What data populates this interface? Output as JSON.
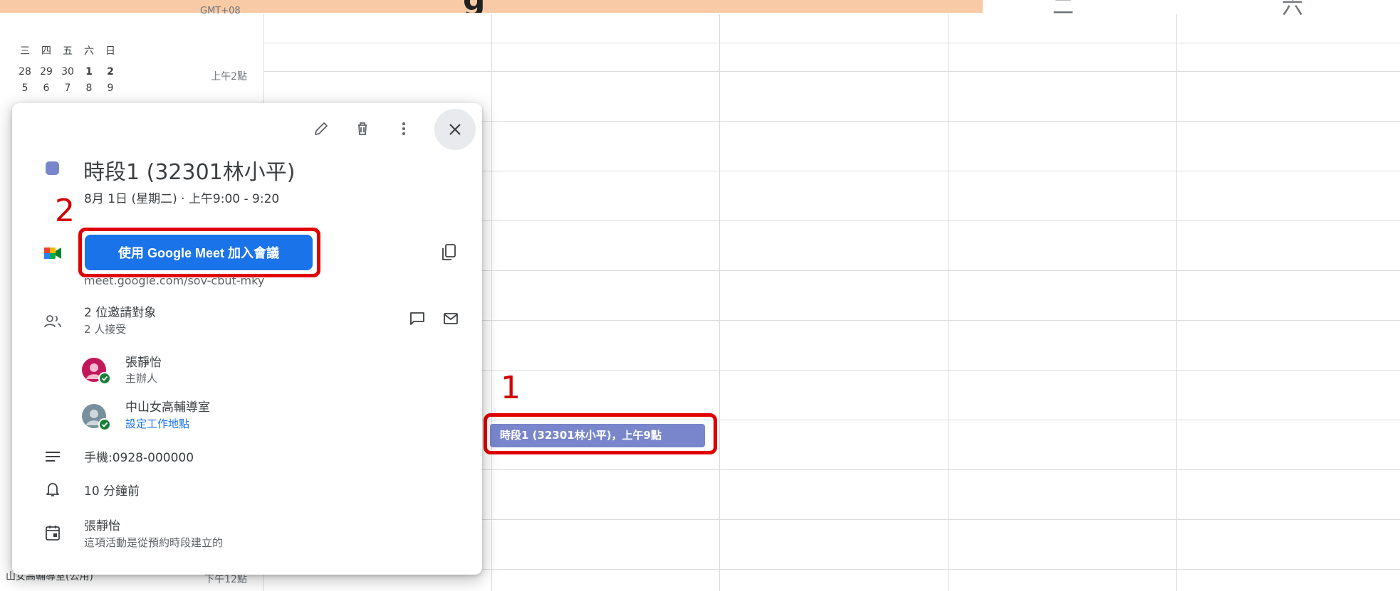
{
  "banner": {
    "glyph": "g"
  },
  "header": {
    "timezone": "GMT+08",
    "day_left": "二",
    "day_right": "六"
  },
  "mini_calendar": {
    "weekdays": [
      "三",
      "四",
      "五",
      "六",
      "日"
    ],
    "row1": [
      "28",
      "29",
      "30",
      "1",
      "2"
    ],
    "row2": [
      "5",
      "6",
      "7",
      "8",
      "9"
    ]
  },
  "time_labels": {
    "t2am": "上午2點",
    "t12pm": "下午12點"
  },
  "sidebar_fragment": {
    "bottom_text": "山女高輔導室(公用)"
  },
  "event_chip": {
    "label": "時段1 (32301林小平)，上午9點"
  },
  "annotations": {
    "n1": "1",
    "n2": "2"
  },
  "popup": {
    "title": "時段1 (32301林小平)",
    "datetime": "8月 1日 (星期二) · 上午9:00 - 9:20",
    "meet_button": "使用 Google Meet 加入會議",
    "meet_link": "meet.google.com/sov-cbut-mky",
    "guests_count": "2 位邀請對象",
    "guests_accepted": "2 人接受",
    "guests": [
      {
        "name": "張靜怡",
        "role": "主辦人",
        "color": "#c2185b"
      },
      {
        "name": "中山女高輔導室",
        "role": "設定工作地點",
        "color": "#78909c"
      }
    ],
    "description": "手機:0928-000000",
    "reminder": "10 分鐘前",
    "calendar_owner": "張靜怡",
    "calendar_note": "這項活動是從預約時段建立的"
  },
  "colors": {
    "event": "#7986cb",
    "meet_button": "#1a73e8",
    "annotation": "#e00000"
  },
  "icons": {
    "edit": "pencil-icon",
    "delete": "trash-icon",
    "more": "more-vert-icon",
    "close": "close-icon",
    "copy": "copy-icon",
    "people": "people-icon",
    "chat": "chat-icon",
    "email": "email-icon",
    "description": "notes-icon",
    "reminder": "bell-icon",
    "calendar": "calendar-icon",
    "meet": "google-meet-icon"
  }
}
